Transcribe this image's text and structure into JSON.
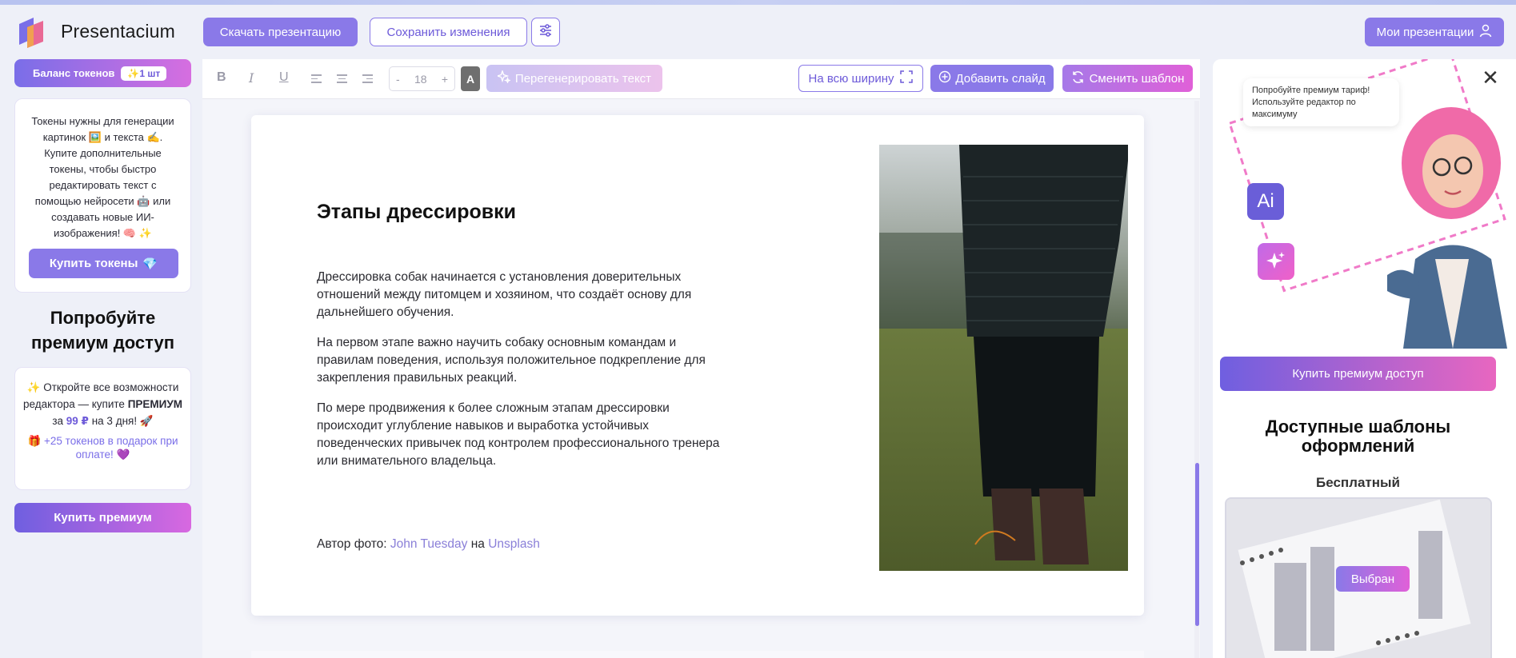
{
  "app": {
    "brand": "Presentacium"
  },
  "header": {
    "download_label": "Скачать презентацию",
    "save_label": "Сохранить изменения",
    "my_presentations_label": "Мои презентации"
  },
  "tokens": {
    "balance_label": "Баланс токенов",
    "balance_value": "1 шт",
    "info_text": "Токены нужны для генерации картинок 🖼️ и текста ✍️. Купите дополнительные токены, чтобы быстро редактировать текст с помощью нейросети 🤖 или создавать новые ИИ-изображения! 🧠 ✨",
    "buy_label": "Купить токены"
  },
  "premium": {
    "title": "Попробуйте премиум доступ",
    "text_start": "Откройте все возможности редактора — купите",
    "text_bold": "ПРЕМИУМ",
    "text_mid": "за",
    "price": "99 ₽",
    "text_end": "на 3 дня!",
    "gift": "+25 токенов в подарок при оплате!",
    "buy_label": "Купить премиум"
  },
  "toolbar": {
    "bold": "B",
    "italic": "I",
    "underline": "U",
    "font_size": "18",
    "minus": "-",
    "plus": "+",
    "color_letter": "A",
    "regenerate_label": "Перегенерировать текст",
    "full_width_label": "На всю ширину",
    "add_slide_label": "Добавить слайд",
    "change_template_label": "Сменить шаблон"
  },
  "slide": {
    "title": "Этапы дрессировки",
    "paragraphs": [
      "Дрессировка собак начинается с установления доверительных отношений между питомцем и хозяином, что создаёт основу для дальнейшего обучения.",
      "На первом этапе важно научить собаку основным командам и правилам поведения, используя положительное подкрепление для закрепления правильных реакций.",
      "По мере продвижения к более сложным этапам дрессировки происходит углубление навыков и выработка устойчивых поведенческих привычек под контролем профессионального тренера или внимательного владельца."
    ],
    "credit_prefix": "Автор фото:",
    "credit_author": "John Tuesday",
    "credit_mid": "на",
    "credit_source": "Unsplash"
  },
  "right_panel": {
    "bubble_text": "Попробуйте премиум тариф! Используйте редактор по максимуму",
    "ai_badge": "Ai",
    "buy_premium_label": "Купить премиум доступ",
    "templates_title": "Доступные шаблоны оформлений",
    "free_label": "Бесплатный",
    "selected_label": "Выбран"
  },
  "colors": {
    "accent": "#8a79e8",
    "accent_pink": "#e060d8",
    "background": "#eef0f8"
  }
}
